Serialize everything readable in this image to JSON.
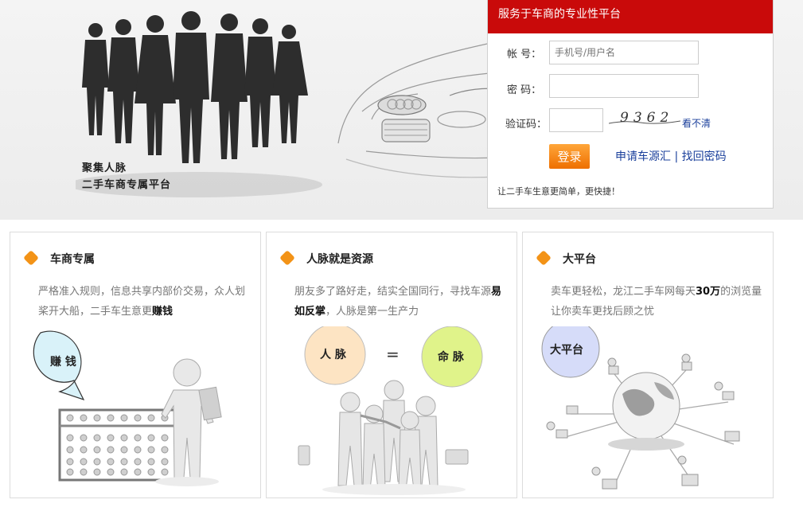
{
  "banner": {
    "slogan_line1": "聚集人脉",
    "slogan_line2": "二手车商专属平台"
  },
  "login": {
    "header": "服务于车商的专业性平台",
    "account_label": "帐 号：",
    "account_placeholder": "手机号/用户名",
    "password_label": "密 码：",
    "captcha_label": "验证码：",
    "captcha_text": "9362",
    "refresh_label": "看不清",
    "submit_label": "登录",
    "apply_link": "申请车源汇",
    "separator": "|",
    "forgot_link": "找回密码",
    "tagline": "让二手车生意更简单，更快捷！"
  },
  "features": [
    {
      "title": "车商专属",
      "desc_pre": "严格准入规则，信息共享内部价交易，众人划桨开大船，二手车生意更",
      "desc_bold": "赚钱",
      "desc_post": "",
      "bubble": "赚 钱"
    },
    {
      "title": "人脉就是资源",
      "desc_pre": "朋友多了路好走，结实全国同行，寻找车源",
      "desc_bold": "易如反掌",
      "desc_post": "，人脉是第一生产力",
      "bubble_left": "人 脉",
      "bubble_mid": "=",
      "bubble_right": "命 脉"
    },
    {
      "title": "大平台",
      "desc_pre": "卖车更轻松，龙江二手车网每天",
      "desc_bold": "30万",
      "desc_post": "的浏览量让你卖车更找后顾之忧",
      "bubble": "大平台"
    }
  ],
  "colors": {
    "brand_red": "#c90a0a",
    "accent_orange": "#f39317",
    "link_blue": "#1a3f9b"
  }
}
